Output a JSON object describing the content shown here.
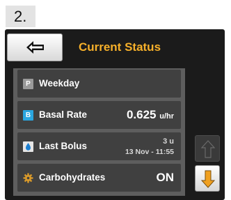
{
  "step": {
    "label": "2."
  },
  "screen": {
    "title": "Current Status",
    "back_icon": "arrow-left-icon",
    "rows": [
      {
        "icon": "P",
        "label": "Weekday"
      },
      {
        "icon": "B",
        "label": "Basal Rate",
        "value": "0.625",
        "unit": "u/hr"
      },
      {
        "icon": "drop-icon",
        "label": "Last Bolus",
        "value_line1": "3 u",
        "value_line2": "13 Nov - 11:55"
      },
      {
        "icon": "gear-icon",
        "label": "Carbohydrates",
        "value": "ON"
      }
    ],
    "scroll": {
      "up_icon": "arrow-up-icon",
      "down_icon": "arrow-down-icon"
    }
  },
  "colors": {
    "title": "#f6b02a",
    "scroll_down": "#f0a020",
    "basal_icon": "#2aa6e0",
    "panel": "#1b1b1b",
    "row": "#404040"
  }
}
